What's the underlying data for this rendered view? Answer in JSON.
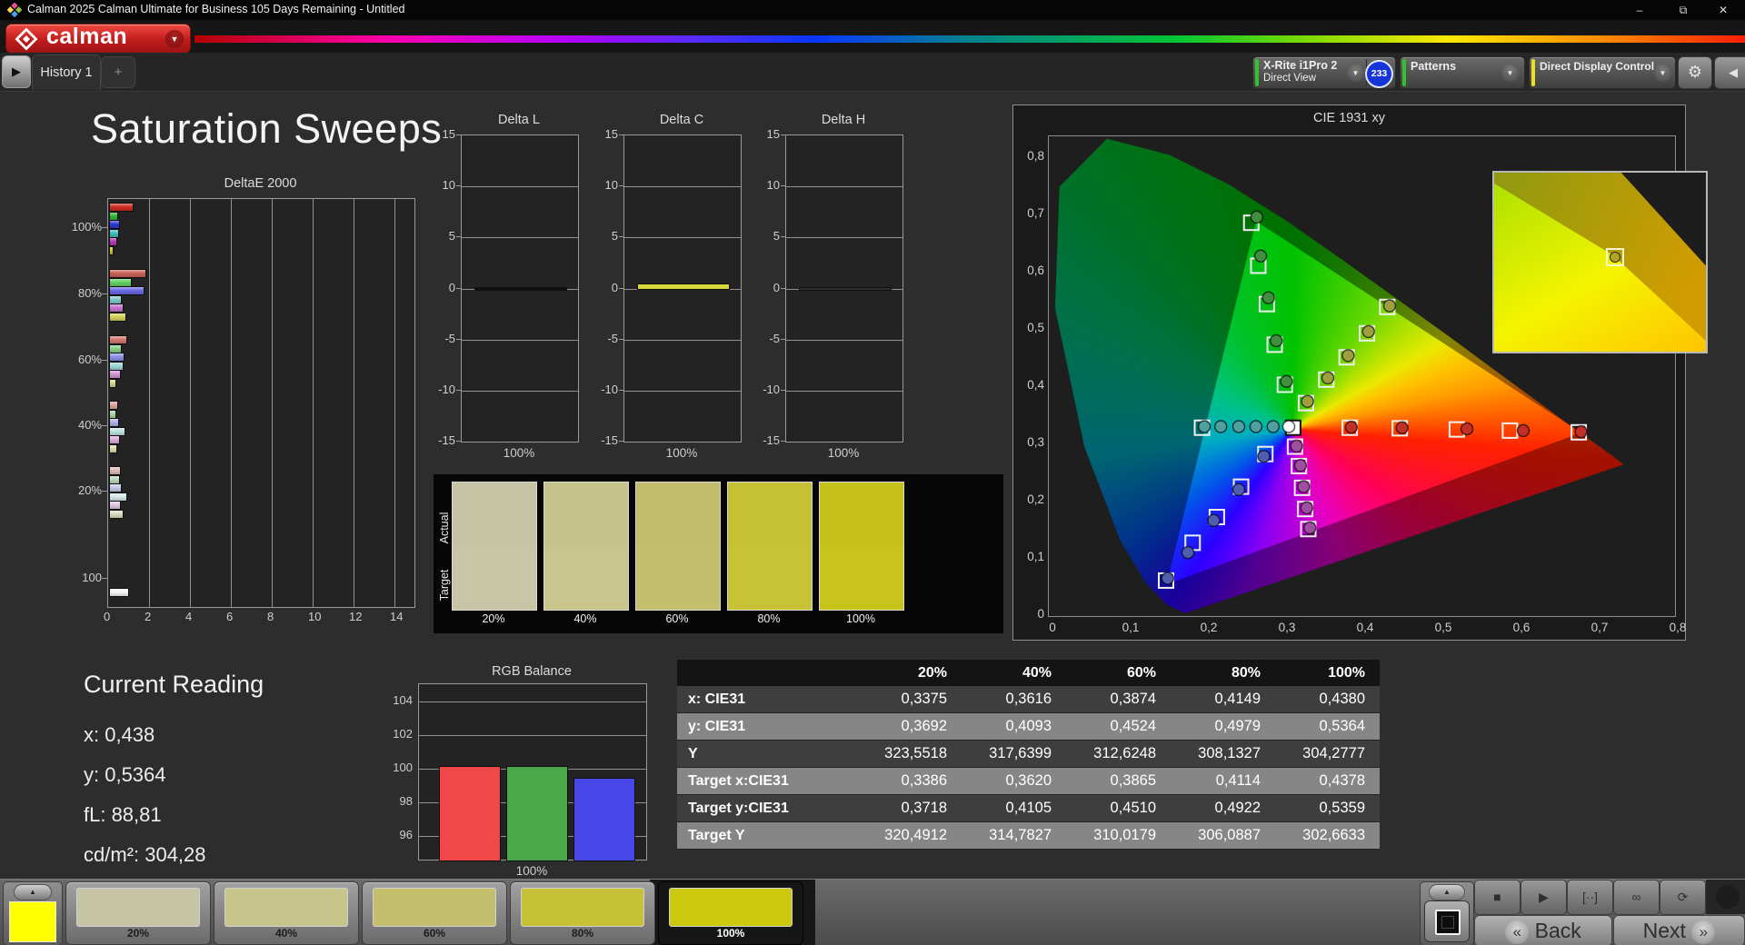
{
  "window": {
    "title": "Calman 2025 Calman Ultimate for Business 105 Days Remaining  - Untitled",
    "minimize": "–",
    "restore": "⧉",
    "close": "✕"
  },
  "brand": {
    "logo_text": "calman",
    "dropdown_icon": "▼"
  },
  "tab_bar": {
    "scroll_icon": "▶",
    "history_tab": "History 1",
    "add_tab": "+"
  },
  "toolbar": {
    "meter": {
      "line1": "X-Rite i1Pro 2",
      "line2": "Direct View",
      "badge": "233",
      "accent": "#2ec42e",
      "badge_color": "#1535d8"
    },
    "patterns": {
      "label": "Patterns",
      "accent": "#2ec42e"
    },
    "display_control": {
      "label": "Direct Display Control",
      "accent": "#e8e020"
    },
    "gear_icon": "⚙",
    "collapse_icon": "◀",
    "dropdown_icon": "▼"
  },
  "page": {
    "title": "Saturation Sweeps"
  },
  "current_reading": {
    "title": "Current Reading",
    "x": "x: 0,438",
    "y": "y: 0,5364",
    "fl": "fL: 88,81",
    "cdm2": "cd/m²: 304,28"
  },
  "swatch_panel": {
    "row_labels": [
      "Actual",
      "Target"
    ],
    "columns": [
      {
        "label": "20%",
        "actual": "#c6c3a4",
        "target": "#c8c5a6"
      },
      {
        "label": "40%",
        "actual": "#c6c38b",
        "target": "#c8c58d"
      },
      {
        "label": "60%",
        "actual": "#c2bd6b",
        "target": "#c4bf6d"
      },
      {
        "label": "80%",
        "actual": "#c6c134",
        "target": "#c8c336"
      },
      {
        "label": "100%",
        "actual": "#c6c219",
        "target": "#c8c41b"
      }
    ]
  },
  "measurement_table": {
    "columns": [
      "20%",
      "40%",
      "60%",
      "80%",
      "100%"
    ],
    "rows": [
      {
        "label": "x: CIE31",
        "values": [
          "0,3375",
          "0,3616",
          "0,3874",
          "0,4149",
          "0,4380"
        ]
      },
      {
        "label": "y: CIE31",
        "values": [
          "0,3692",
          "0,4093",
          "0,4524",
          "0,4979",
          "0,5364"
        ]
      },
      {
        "label": "Y",
        "values": [
          "323,5518",
          "317,6399",
          "312,6248",
          "308,1327",
          "304,2777"
        ]
      },
      {
        "label": "Target x:CIE31",
        "values": [
          "0,3386",
          "0,3620",
          "0,3865",
          "0,4114",
          "0,4378"
        ]
      },
      {
        "label": "Target y:CIE31",
        "values": [
          "0,3718",
          "0,4105",
          "0,4510",
          "0,4922",
          "0,5359"
        ]
      },
      {
        "label": "Target Y",
        "values": [
          "320,4912",
          "314,7827",
          "310,0179",
          "306,0887",
          "302,6633"
        ]
      }
    ]
  },
  "bottom_bar": {
    "pattern_color": "#ffff00",
    "swatches": [
      {
        "label": "20%",
        "color": "#c7c4a5",
        "selected": false
      },
      {
        "label": "40%",
        "color": "#c7c48c",
        "selected": false
      },
      {
        "label": "60%",
        "color": "#c3bf6c",
        "selected": false
      },
      {
        "label": "80%",
        "color": "#c7c235",
        "selected": false
      },
      {
        "label": "100%",
        "color": "#cdc90e",
        "selected": true
      }
    ],
    "transport": [
      {
        "name": "stop",
        "glyph": "■"
      },
      {
        "name": "play",
        "glyph": "▶"
      },
      {
        "name": "pattern-window",
        "glyph": "[··]"
      },
      {
        "name": "continuous",
        "glyph": "∞"
      },
      {
        "name": "loop",
        "glyph": "⟳"
      }
    ],
    "back_label": "Back",
    "next_label": "Next",
    "back_chevron": "«",
    "next_chevron": "»",
    "up_icon": "▲"
  },
  "chart_data": [
    {
      "id": "delta_e_2000",
      "type": "bar",
      "orientation": "horizontal",
      "title": "DeltaE 2000",
      "xlim": [
        0,
        15
      ],
      "xticks": [
        0,
        2,
        4,
        6,
        8,
        10,
        12,
        14
      ],
      "group_offsets": [
        4,
        77,
        150,
        222,
        294,
        428
      ],
      "groups": [
        {
          "label": "100%",
          "values": [
            1.1,
            0.35,
            0.45,
            0.4,
            0.3,
            0.15
          ],
          "colors": [
            "#cf2d23",
            "#2fb93a",
            "#2a3ad6",
            "#3fbdbd",
            "#b73ab7",
            "#c9c92e"
          ]
        },
        {
          "label": "80%",
          "values": [
            1.75,
            1.0,
            1.65,
            0.55,
            0.6,
            0.75
          ],
          "colors": [
            "#c96058",
            "#62d162",
            "#6a6ae6",
            "#7ecaca",
            "#c473ce",
            "#d2d257"
          ]
        },
        {
          "label": "60%",
          "values": [
            0.8,
            0.55,
            0.65,
            0.6,
            0.5,
            0.25
          ],
          "colors": [
            "#d4786f",
            "#85d085",
            "#8b90e8",
            "#9cd6d6",
            "#d195d6",
            "#d6d68c"
          ]
        },
        {
          "label": "40%",
          "values": [
            0.35,
            0.25,
            0.4,
            0.7,
            0.45,
            0.3
          ],
          "colors": [
            "#dda49c",
            "#a8d4a4",
            "#acb2ea",
            "#c0e0e0",
            "#dcaede",
            "#dcdcaa"
          ]
        },
        {
          "label": "20%",
          "values": [
            0.5,
            0.45,
            0.55,
            0.8,
            0.5,
            0.6
          ],
          "colors": [
            "#e2bcb8",
            "#bcd8bc",
            "#c4c8ec",
            "#d4e8e8",
            "#e0c6e2",
            "#dddcc0"
          ]
        },
        {
          "label": "100",
          "values": [
            0.9
          ],
          "colors": [
            "#f5f5f5"
          ]
        }
      ]
    },
    {
      "id": "delta_l",
      "type": "bar",
      "title": "Delta L",
      "ylim": [
        -15,
        15
      ],
      "yticks": [
        15,
        10,
        5,
        0,
        -5,
        -10,
        -15
      ],
      "categories": [
        "100%"
      ],
      "values": [
        0.12
      ],
      "bar_color": "#111111"
    },
    {
      "id": "delta_c",
      "type": "bar",
      "title": "Delta C",
      "ylim": [
        -15,
        15
      ],
      "yticks": [
        15,
        10,
        5,
        0,
        -5,
        -10,
        -15
      ],
      "categories": [
        "100%"
      ],
      "values": [
        0.5
      ],
      "bar_color": "#d6d63a"
    },
    {
      "id": "delta_h",
      "type": "bar",
      "title": "Delta H",
      "ylim": [
        -15,
        15
      ],
      "yticks": [
        15,
        10,
        5,
        0,
        -5,
        -10,
        -15
      ],
      "categories": [
        "100%"
      ],
      "values": [
        0.1
      ],
      "bar_color": "#2e2e2e"
    },
    {
      "id": "rgb_balance",
      "type": "bar",
      "title": "RGB Balance",
      "ylim": [
        94.6,
        105.0
      ],
      "yticks": [
        104,
        102,
        100,
        98,
        96
      ],
      "categories": [
        "100%"
      ],
      "series": [
        {
          "name": "Red",
          "value": 100.15,
          "color": "#f04848"
        },
        {
          "name": "Green",
          "value": 100.15,
          "color": "#4aa84a"
        },
        {
          "name": "Blue",
          "value": 99.45,
          "color": "#4848e8"
        }
      ]
    },
    {
      "id": "cie_1931",
      "type": "scatter",
      "title": "CIE 1931 xy",
      "xlim": [
        0,
        0.8
      ],
      "ylim": [
        0,
        0.8
      ],
      "xticks": [
        "0",
        "0,1",
        "0,2",
        "0,3",
        "0,4",
        "0,5",
        "0,6",
        "0,7",
        "0,8"
      ],
      "yticks": [
        "0",
        "0,1",
        "0,2",
        "0,3",
        "0,4",
        "0,5",
        "0,6",
        "0,7",
        "0,8"
      ],
      "gamut_triangle": [
        [
          0.265,
          0.69
        ],
        [
          0.68,
          0.32
        ],
        [
          0.15,
          0.055
        ]
      ],
      "series": [
        {
          "name": "red",
          "marker_color": "#c03028",
          "targets": [
            [
              0.385,
              0.329
            ],
            [
              0.449,
              0.328
            ],
            [
              0.522,
              0.326
            ],
            [
              0.59,
              0.324
            ],
            [
              0.678,
              0.321
            ]
          ],
          "measured": [
            [
              0.387,
              0.33
            ],
            [
              0.452,
              0.329
            ],
            [
              0.535,
              0.327
            ],
            [
              0.607,
              0.324
            ],
            [
              0.681,
              0.322
            ]
          ]
        },
        {
          "name": "green",
          "marker_color": "#3f8f3f",
          "targets": [
            [
              0.302,
              0.404
            ],
            [
              0.289,
              0.474
            ],
            [
              0.279,
              0.545
            ],
            [
              0.268,
              0.612
            ],
            [
              0.259,
              0.687
            ]
          ],
          "measured": [
            [
              0.304,
              0.41
            ],
            [
              0.291,
              0.481
            ],
            [
              0.281,
              0.556
            ],
            [
              0.271,
              0.629
            ],
            [
              0.266,
              0.697
            ]
          ]
        },
        {
          "name": "blue",
          "marker_color": "#4f5fae",
          "targets": [
            [
              0.277,
              0.283
            ],
            [
              0.246,
              0.226
            ],
            [
              0.215,
              0.173
            ],
            [
              0.184,
              0.128
            ],
            [
              0.15,
              0.062
            ]
          ],
          "measured": [
            [
              0.275,
              0.279
            ],
            [
              0.243,
              0.221
            ],
            [
              0.211,
              0.167
            ],
            [
              0.178,
              0.111
            ],
            [
              0.152,
              0.066
            ]
          ]
        },
        {
          "name": "cyan",
          "marker_color": "#4fa0a0",
          "targets": [
            [
              0.196,
              0.329
            ]
          ],
          "measured": [
            [
              0.199,
              0.331
            ],
            [
              0.22,
              0.331
            ],
            [
              0.243,
              0.331
            ],
            [
              0.265,
              0.331
            ],
            [
              0.287,
              0.331
            ]
          ]
        },
        {
          "name": "magenta",
          "marker_color": "#9f4f9f",
          "targets": [
            [
              0.315,
              0.296
            ],
            [
              0.32,
              0.262
            ],
            [
              0.324,
              0.224
            ],
            [
              0.328,
              0.187
            ],
            [
              0.332,
              0.152
            ]
          ],
          "measured": [
            [
              0.317,
              0.297
            ],
            [
              0.322,
              0.263
            ],
            [
              0.326,
              0.226
            ],
            [
              0.33,
              0.189
            ],
            [
              0.334,
              0.154
            ]
          ]
        },
        {
          "name": "yellow",
          "marker_color": "#9f9f3f",
          "targets": [
            [
              0.329,
              0.372
            ],
            [
              0.355,
              0.413
            ],
            [
              0.381,
              0.452
            ],
            [
              0.407,
              0.494
            ],
            [
              0.433,
              0.54
            ]
          ],
          "measured": [
            [
              0.331,
              0.375
            ],
            [
              0.357,
              0.416
            ],
            [
              0.383,
              0.455
            ],
            [
              0.409,
              0.497
            ],
            [
              0.436,
              0.542
            ]
          ]
        },
        {
          "name": "white",
          "marker_color": "#ffffff",
          "targets": [
            [
              0.3127,
              0.329
            ]
          ],
          "measured": [
            [
              0.307,
              0.331
            ]
          ]
        }
      ]
    }
  ]
}
